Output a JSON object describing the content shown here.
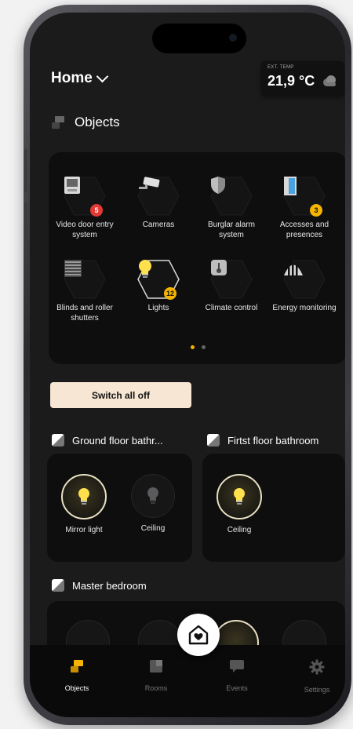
{
  "header": {
    "location": "Home"
  },
  "temperature": {
    "label": "EXT. TEMP",
    "value": "21,9 °C",
    "icon": "cloud-icon"
  },
  "objects_section": {
    "title": "Objects"
  },
  "objects": [
    {
      "label": "Video door entry system",
      "icon": "intercom-icon",
      "badge": "5",
      "badge_color": "#e53935"
    },
    {
      "label": "Cameras",
      "icon": "camera-icon"
    },
    {
      "label": "Burglar alarm system",
      "icon": "shield-icon"
    },
    {
      "label": "Accesses and presences",
      "icon": "door-icon",
      "badge": "3",
      "badge_color": "#f4b400"
    },
    {
      "label": "Blinds and roller shutters",
      "icon": "blinds-icon"
    },
    {
      "label": "Lights",
      "icon": "bulb-icon",
      "badge": "12",
      "badge_color": "#f4b400",
      "active": true
    },
    {
      "label": "Climate control",
      "icon": "thermometer-icon"
    },
    {
      "label": "Energy monitoring",
      "icon": "energy-icon"
    }
  ],
  "pager": {
    "total": 2,
    "active": 0
  },
  "switch_all": {
    "label": "Switch all off"
  },
  "rooms": [
    {
      "name": "Ground floor bathr...",
      "devices": [
        {
          "label": "Mirror light",
          "state": "on"
        },
        {
          "label": "Ceiling",
          "state": "off"
        }
      ]
    },
    {
      "name": "Firtst floor bathroom",
      "devices": [
        {
          "label": "Ceiling",
          "state": "on"
        }
      ]
    },
    {
      "name": "Master bedroom",
      "devices": []
    }
  ],
  "nav": [
    {
      "label": "Objects",
      "icon": "objects-icon",
      "active": true
    },
    {
      "label": "Rooms",
      "icon": "rooms-icon",
      "active": false
    },
    {
      "label": "Events",
      "icon": "events-icon",
      "active": false
    },
    {
      "label": "Settings",
      "icon": "settings-icon",
      "active": false
    }
  ],
  "colors": {
    "accent": "#f4b400",
    "badge_red": "#e53935",
    "button_bg": "#f6e6d3",
    "bulb_yellow": "#ffe04d"
  }
}
